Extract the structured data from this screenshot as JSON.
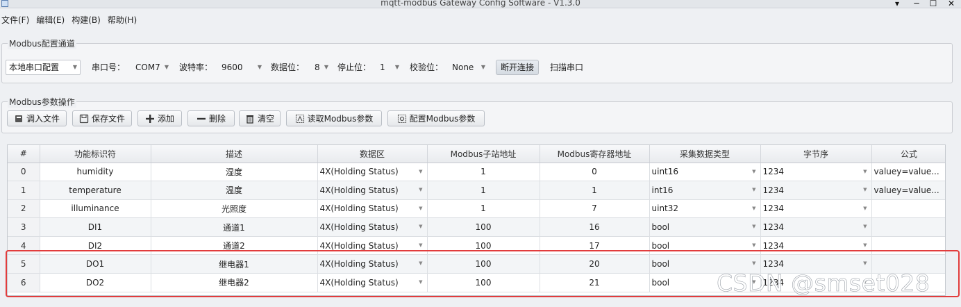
{
  "window": {
    "title": "mqtt-modbus Gateway Config Software - V1.3.0",
    "controls": {
      "minimize": "▾",
      "restore": "─",
      "maximize": "☐",
      "close": "✕"
    }
  },
  "menu": [
    "文件(F)",
    "编辑(E)",
    "构建(B)",
    "帮助(H)"
  ],
  "serial_group": {
    "title": "Modbus配置通道",
    "mode": "本地串口配置",
    "port_label": "串口号：",
    "port_value": "COM7",
    "baud_label": "波特率：",
    "baud_value": "9600",
    "databits_label": "数据位：",
    "databits_value": "8",
    "stopbits_label": "停止位：",
    "stopbits_value": "1",
    "parity_label": "校验位：",
    "parity_value": "None",
    "disconnect_label": "断开连接",
    "scan_label": "扫描串口"
  },
  "param_group": {
    "title": "Modbus参数操作",
    "import_label": "调入文件",
    "save_label": "保存文件",
    "add_label": "添加",
    "delete_label": "删除",
    "clear_label": "清空",
    "read_label": "读取Modbus参数",
    "config_label": "配置Modbus参数"
  },
  "table": {
    "headers": [
      "#",
      "功能标识符",
      "描述",
      "数据区",
      "Modbus子站地址",
      "Modbus寄存器地址",
      "采集数据类型",
      "字节序",
      "公式"
    ],
    "rows": [
      [
        "0",
        "humidity",
        "湿度",
        "4X(Holding Status)",
        "1",
        "0",
        "uint16",
        "1234",
        "valuey=value..."
      ],
      [
        "1",
        "temperature",
        "温度",
        "4X(Holding Status)",
        "1",
        "1",
        "int16",
        "1234",
        "valuey=value..."
      ],
      [
        "2",
        "illuminance",
        "光照度",
        "4X(Holding Status)",
        "1",
        "7",
        "uint32",
        "1234",
        ""
      ],
      [
        "3",
        "DI1",
        "通道1",
        "4X(Holding Status)",
        "100",
        "16",
        "bool",
        "1234",
        ""
      ],
      [
        "4",
        "DI2",
        "通道2",
        "4X(Holding Status)",
        "100",
        "17",
        "bool",
        "1234",
        ""
      ],
      [
        "5",
        "DO1",
        "继电器1",
        "4X(Holding Status)",
        "100",
        "20",
        "bool",
        "1234",
        ""
      ],
      [
        "6",
        "DO2",
        "继电器2",
        "4X(Holding Status)",
        "100",
        "21",
        "bool",
        "1234",
        ""
      ]
    ]
  },
  "watermark": "CSDN @smset028",
  "colors": {
    "highlight": "#e23c3c",
    "background": "#eef0f3"
  }
}
